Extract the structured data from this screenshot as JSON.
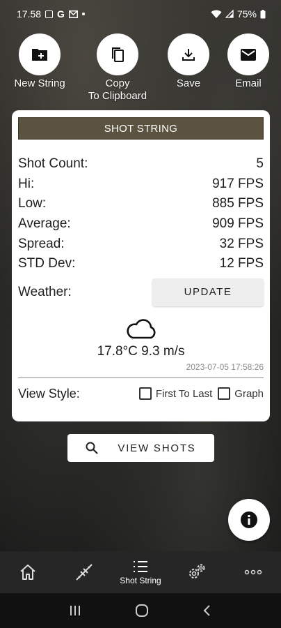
{
  "status_bar": {
    "time": "17.58",
    "notif_glyphs": [
      "G"
    ],
    "battery": "75%"
  },
  "actions": {
    "new_string": "New String",
    "copy_line1": "Copy",
    "copy_line2": "To Clipboard",
    "save": "Save",
    "email": "Email"
  },
  "card": {
    "header": "SHOT STRING",
    "stats": [
      {
        "label": "Shot Count:",
        "value": "5"
      },
      {
        "label": "Hi:",
        "value": "917 FPS"
      },
      {
        "label": "Low:",
        "value": "885 FPS"
      },
      {
        "label": "Average:",
        "value": "909 FPS"
      },
      {
        "label": "Spread:",
        "value": "32 FPS"
      },
      {
        "label": "STD Dev:",
        "value": "12 FPS"
      }
    ],
    "weather_label": "Weather:",
    "update_button": "UPDATE",
    "weather_icon": "cloud-icon",
    "weather_text": "17.8°C 9.3 m/s",
    "timestamp": "2023-07-05 17:58:26",
    "view_style_label": "View Style:",
    "option_first_to_last": "First To Last",
    "option_graph": "Graph"
  },
  "view_shots_button": "VIEW SHOTS",
  "bottom_nav": {
    "shot_string_label": "Shot String"
  },
  "colors": {
    "header_bg": "#5b5340",
    "nav_bg": "#262626"
  }
}
